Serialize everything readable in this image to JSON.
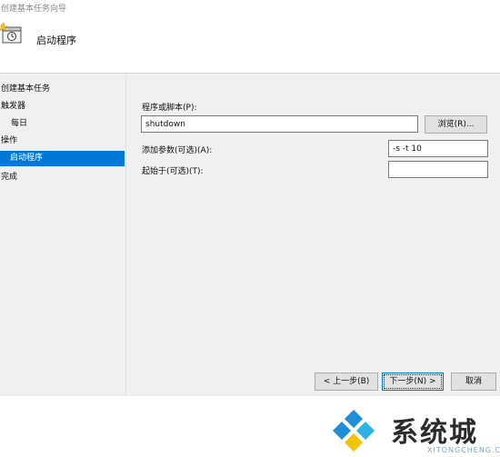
{
  "window": {
    "title": "创建基本任务向导",
    "page_title": "启动程序"
  },
  "sidebar": {
    "items": [
      {
        "label": "创建基本任务"
      },
      {
        "label": "触发器"
      },
      {
        "label": "每日"
      },
      {
        "label": "操作"
      },
      {
        "label": "启动程序"
      },
      {
        "label": "完成"
      }
    ]
  },
  "form": {
    "program_label": "程序或脚本(P):",
    "program_value": "shutdown",
    "browse_label": "浏览(R)...",
    "args_label": "添加参数(可选)(A):",
    "args_value": "-s -t 10",
    "startin_label": "起始于(可选)(T):",
    "startin_value": ""
  },
  "footer": {
    "back_label": "< 上一步(B)",
    "next_label": "下一步(N) >",
    "cancel_label": "取消"
  },
  "watermark": {
    "text": "系统城",
    "sub": "XITONGCHENG.COM"
  }
}
